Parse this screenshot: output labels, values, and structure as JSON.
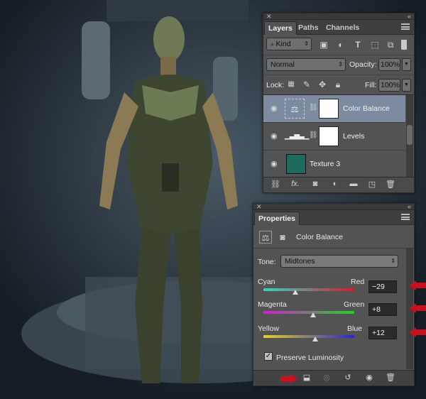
{
  "layers_panel": {
    "tabs": [
      {
        "label": "Layers",
        "active": true
      },
      {
        "label": "Paths",
        "active": false
      },
      {
        "label": "Channels",
        "active": false
      }
    ],
    "filter_kind": "Kind",
    "blend_mode": "Normal",
    "opacity_label": "Opacity:",
    "opacity_value": "100%",
    "lock_label": "Lock:",
    "fill_label": "Fill:",
    "fill_value": "100%",
    "layers": [
      {
        "name": "Color Balance",
        "selected": true,
        "icon": "balance-icon"
      },
      {
        "name": "Levels",
        "selected": false,
        "icon": "levels-icon"
      },
      {
        "name": "Texture 3",
        "selected": false,
        "icon": "texture-thumbnail"
      }
    ]
  },
  "properties_panel": {
    "tab_label": "Properties",
    "title": "Color Balance",
    "tone_label": "Tone:",
    "tone_value": "Midtones",
    "sliders": [
      {
        "left": "Cyan",
        "right": "Red",
        "value": "−29",
        "position": -29
      },
      {
        "left": "Magenta",
        "right": "Green",
        "value": "+8",
        "position": 8
      },
      {
        "left": "Yellow",
        "right": "Blue",
        "value": "+12",
        "position": 12
      }
    ],
    "preserve_luminosity_label": "Preserve Luminosity",
    "preserve_luminosity_checked": true
  },
  "colors": {
    "panel_bg": "#535353",
    "selected_layer": "#7c8ba0",
    "annotation_arrow": "#c8101e"
  }
}
